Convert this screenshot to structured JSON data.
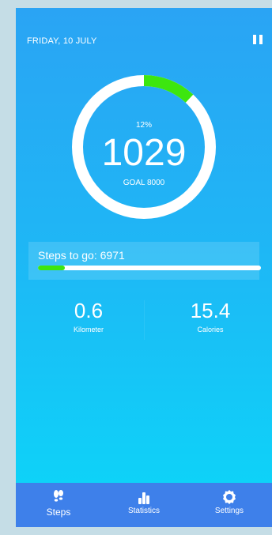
{
  "header": {
    "date": "FRIDAY, 10 JULY"
  },
  "progress": {
    "percent_label": "12%",
    "percent_value": 0.12,
    "steps": "1029",
    "goal_label": "GOAL 8000"
  },
  "steps_to_go": {
    "label": "Steps to go: 6971",
    "fill_fraction": 0.12
  },
  "stats": {
    "distance": {
      "value": "0.6",
      "label": "Kilometer"
    },
    "calories": {
      "value": "15.4",
      "label": "Calories"
    }
  },
  "nav": {
    "items": [
      {
        "label": "Steps",
        "icon": "footprints-icon",
        "active": true
      },
      {
        "label": "Statistics",
        "icon": "bar-chart-icon",
        "active": false
      },
      {
        "label": "Settings",
        "icon": "gear-icon",
        "active": false
      }
    ]
  },
  "colors": {
    "accent_green": "#3de60f",
    "nav_bg": "#3e80ea",
    "ring_track": "#ffffff"
  }
}
